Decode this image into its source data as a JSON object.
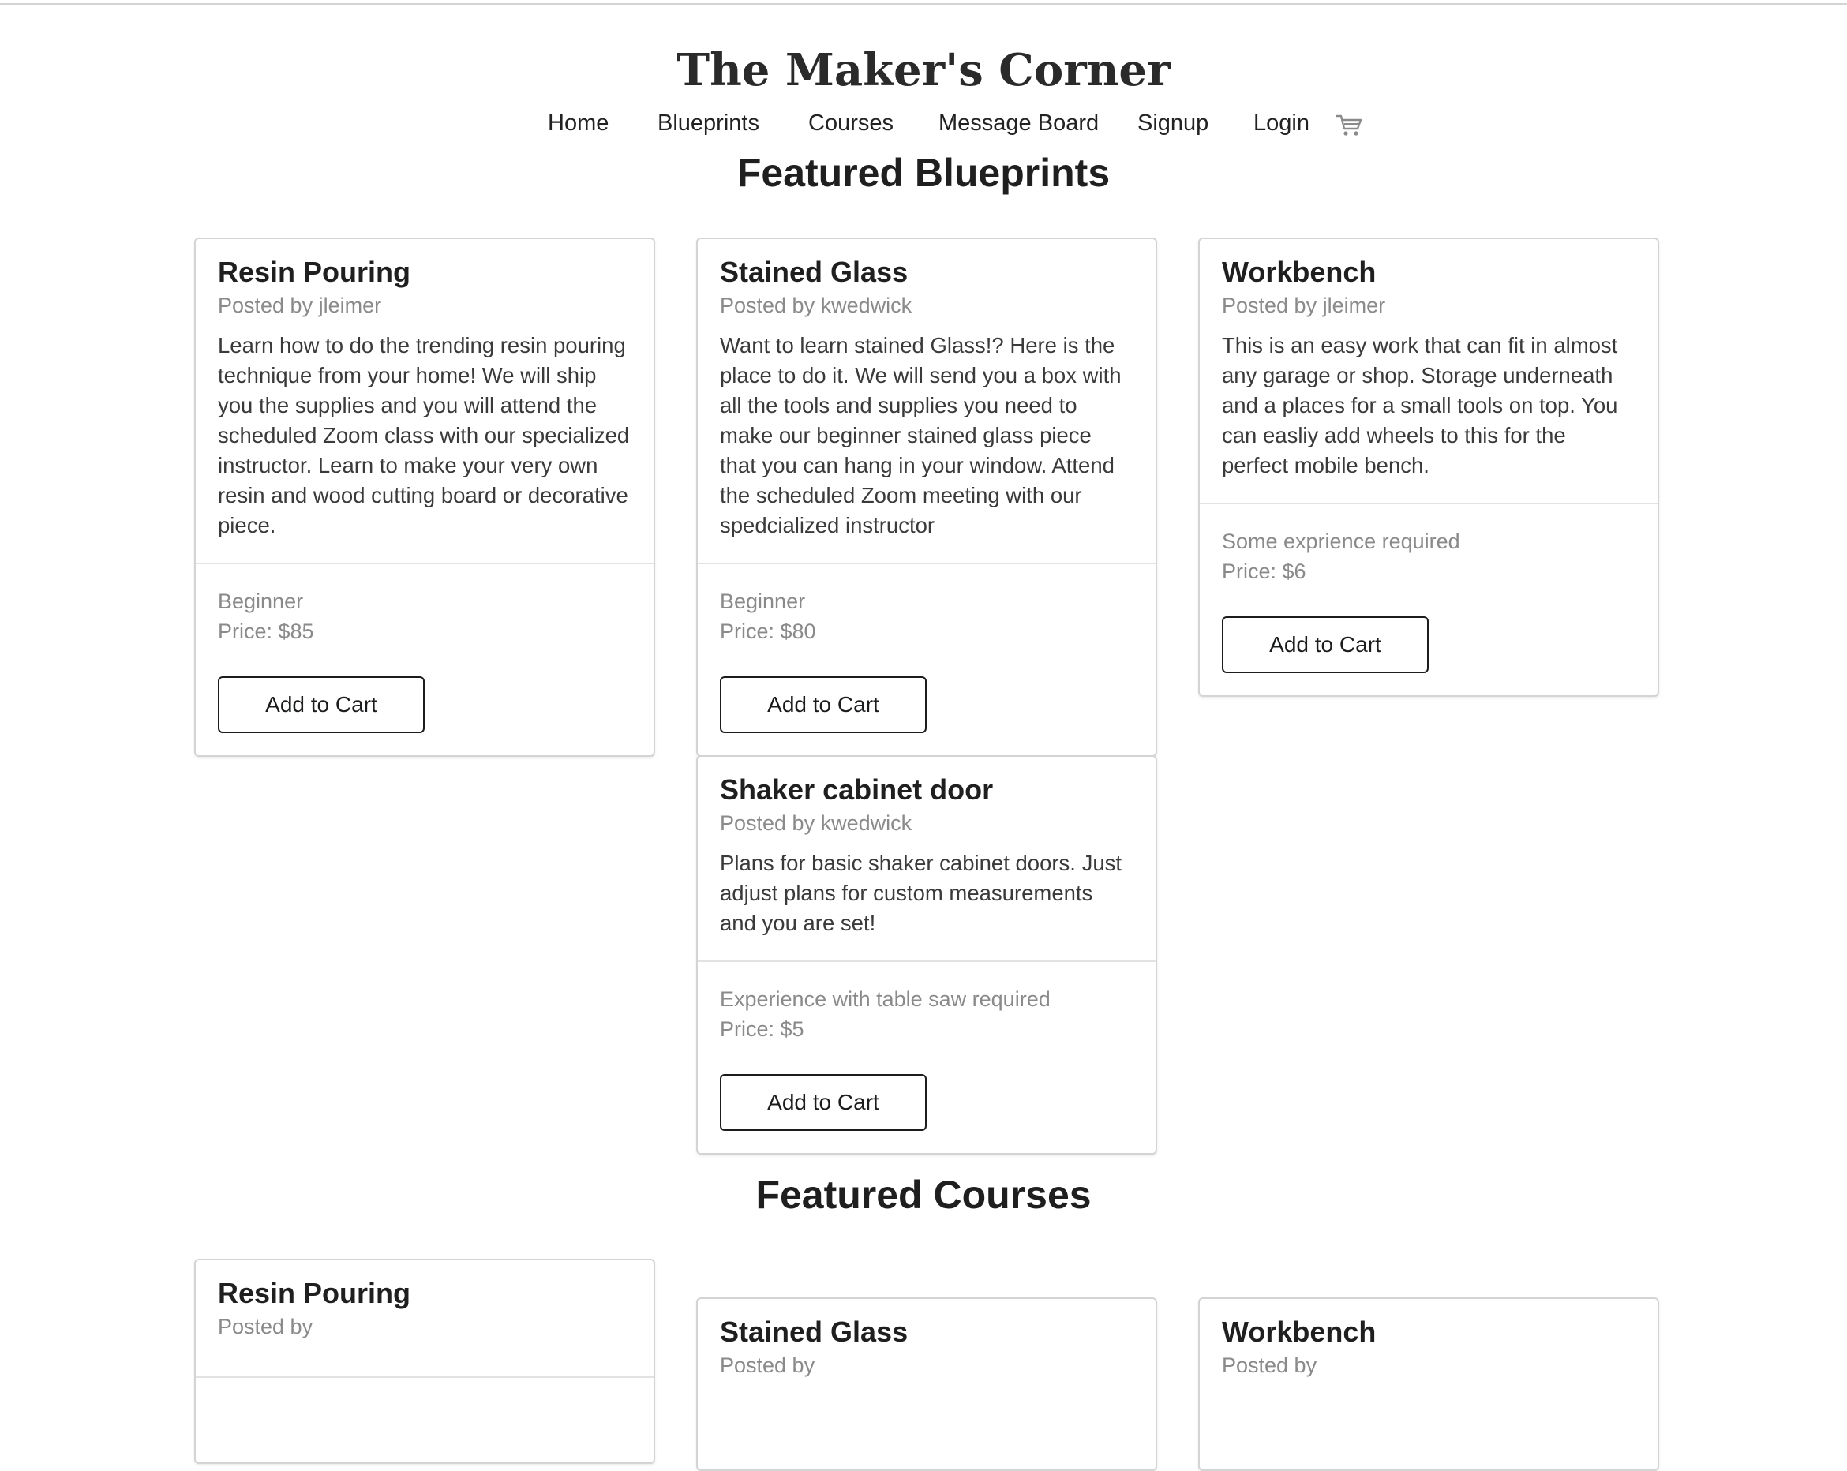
{
  "site": {
    "title": "The Maker's Corner"
  },
  "nav": {
    "items": [
      {
        "label": "Home"
      },
      {
        "label": "Blueprints"
      },
      {
        "label": "Courses"
      },
      {
        "label": "Message Board"
      },
      {
        "label": "Signup"
      },
      {
        "label": "Login"
      }
    ],
    "cart_icon": "shopping-cart-icon"
  },
  "blueprints": {
    "heading": "Featured Blueprints",
    "cards": [
      {
        "title": "Resin Pouring",
        "posted_by": "Posted by jleimer",
        "description": "Learn how to do the trending resin pouring technique from your home! We will ship you the supplies and you will attend the scheduled Zoom class with our specialized instructor. Learn to make your very own resin and wood cutting board or decorative piece.",
        "level": "Beginner",
        "price": "Price: $85",
        "button": "Add to Cart"
      },
      {
        "title": "Stained Glass",
        "posted_by": "Posted by kwedwick",
        "description": "Want to learn stained Glass!? Here is the place to do it. We will send you a box with all the tools and supplies you need to make our beginner stained glass piece that you can hang in your window. Attend the scheduled Zoom meeting with our spedcialized instructor",
        "level": "Beginner",
        "price": "Price: $80",
        "button": "Add to Cart"
      },
      {
        "title": "Workbench",
        "posted_by": "Posted by jleimer",
        "description": "This is an easy work that can fit in almost any garage or shop. Storage underneath and a places for a small tools on top. You can easliy add wheels to this for the perfect mobile bench.",
        "level": "Some exprience required",
        "price": "Price: $6",
        "button": "Add to Cart"
      },
      {
        "title": "Shaker cabinet door",
        "posted_by": "Posted by kwedwick",
        "description": "Plans for basic shaker cabinet doors. Just adjust plans for custom measurements and you are set!",
        "level": "Experience with table saw required",
        "price": "Price: $5",
        "button": "Add to Cart"
      }
    ]
  },
  "courses": {
    "heading": "Featured Courses",
    "cards": [
      {
        "title": "Resin Pouring",
        "posted_by": "Posted by"
      },
      {
        "title": "Stained Glass",
        "posted_by": "Posted by"
      },
      {
        "title": "Workbench",
        "posted_by": "Posted by"
      }
    ]
  }
}
